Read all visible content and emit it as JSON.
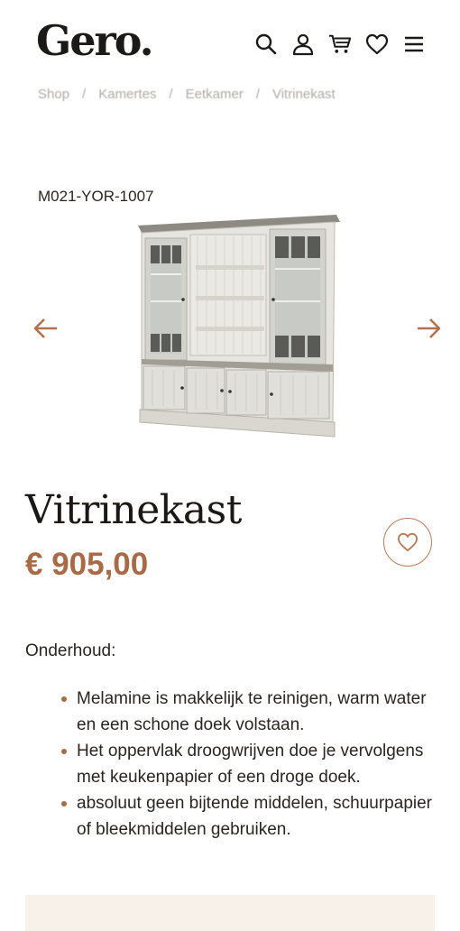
{
  "header": {
    "logo": "Gero.",
    "icons": [
      "search-icon",
      "user-icon",
      "cart-icon",
      "heart-icon",
      "menu-icon"
    ]
  },
  "breadcrumb": [
    "Shop",
    "Kamertes",
    "Eetkamer",
    "Vitrinekast"
  ],
  "product": {
    "sku": "M021-YOR-1007",
    "title": "Vitrinekast",
    "price": "€ 905,00"
  },
  "care": {
    "label": "Onderhoud:",
    "items": [
      "Melamine is makkelijk te reinigen, warm water en een schone doek volstaan.",
      "Het oppervlak droogwrijven doe je vervolgens met keukenpapier of een droge doek.",
      "absoluut geen bijtende middelen, schuurpapier of bleekmiddelen gebruiken."
    ]
  },
  "colors": {
    "accent": "#a86a47",
    "text": "#1e1a17",
    "panel": "#f7f1ea"
  }
}
